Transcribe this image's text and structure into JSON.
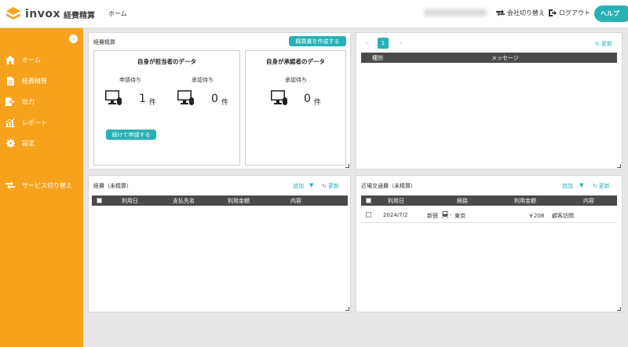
{
  "header": {
    "logo_text": "invox",
    "logo_sub": "経費精算",
    "nav_home": "ホーム",
    "switch_company": "会社切り替え",
    "logout": "ログアウト",
    "help": "ヘルプ"
  },
  "sidebar": {
    "collapse_icon": "chevron-left-icon",
    "items": [
      {
        "label": "ホーム",
        "icon": "home-icon"
      },
      {
        "label": "経費精算",
        "icon": "document-icon"
      },
      {
        "label": "出力",
        "icon": "export-icon"
      },
      {
        "label": "レポート",
        "icon": "chart-icon"
      },
      {
        "label": "設定",
        "icon": "gear-icon"
      },
      {
        "label": "サービス切り替え",
        "icon": "switch-icon"
      }
    ]
  },
  "expense_summary": {
    "title": "経費精算",
    "create_button": "精算書を作成する",
    "my_data": {
      "title": "自身が担当者のデータ",
      "pending_request_label": "申請待ち",
      "pending_request_count": "1",
      "pending_approval_label": "承認待ち",
      "pending_approval_count": "0",
      "unit": "件",
      "continue_button": "続けて申請する"
    },
    "approver_data": {
      "title": "自身が承認者のデータ",
      "pending_approval_label": "承認待ち",
      "pending_approval_count": "0",
      "unit": "件"
    }
  },
  "messages": {
    "page": "1",
    "refresh": "更新",
    "columns": [
      "種別",
      "メッセージ"
    ]
  },
  "expenses": {
    "title": "経費（未精算）",
    "add": "追加",
    "refresh": "更新",
    "columns": [
      "利用日",
      "支払先名",
      "利用金額",
      "内容"
    ]
  },
  "transport": {
    "title": "近場交通費（未精算）",
    "add": "追加",
    "refresh": "更新",
    "columns": [
      "利用日",
      "経路",
      "利用金額",
      "内容"
    ],
    "rows": [
      {
        "date": "2024/7/2",
        "route_from": "新宿",
        "route_to": "東京",
        "amount": "￥208",
        "content": "顧客訪問"
      }
    ]
  },
  "colors": {
    "accent": "#27b1b5",
    "sidebar": "#f7a21d",
    "table_header": "#4a4a4a"
  }
}
